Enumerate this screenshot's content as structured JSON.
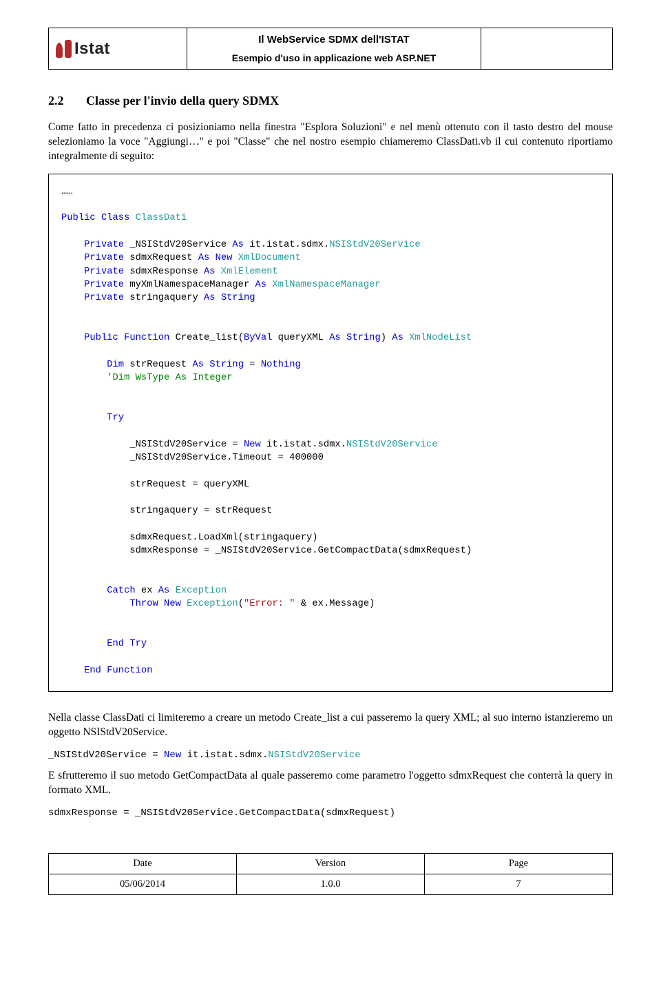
{
  "header": {
    "logo_text": "Istat",
    "title_line1": "Il WebService SDMX dell'ISTAT",
    "title_line2": "Esempio d'uso in applicazione web ASP.NET"
  },
  "section": {
    "num": "2.2",
    "title": "Classe per l'invio della query SDMX"
  },
  "para1": "Come fatto in precedenza ci posizioniamo nella finestra \"Esplora Soluzioni\" e nel menù ottenuto con il tasto destro del mouse selezioniamo la voce \"Aggiungi…\" e poi \"Classe\" che nel nostro esempio chiameremo ClassDati.vb il cui contenuto riportiamo integralmente di seguito:",
  "code": {
    "ellipsis": "……",
    "l1_kw1": "Public",
    "l1_kw2": "Class",
    "l1_type": "ClassDati",
    "l2_kw1": "Private",
    "l2_name": "_NSIStdV20Service",
    "l2_kw2": "As",
    "l2_ns": "it.istat.sdmx.",
    "l2_type": "NSIStdV20Service",
    "l3_kw1": "Private",
    "l3_name": "sdmxRequest",
    "l3_kw2": "As",
    "l3_kw3": "New",
    "l3_type": "XmlDocument",
    "l4_kw1": "Private",
    "l4_name": "sdmxResponse",
    "l4_kw2": "As",
    "l4_type": "XmlElement",
    "l5_kw1": "Private",
    "l5_name": "myXmlNamespaceManager",
    "l5_kw2": "As",
    "l5_type": "XmlNamespaceManager",
    "l6_kw1": "Private",
    "l6_name": "stringaquery",
    "l6_kw2": "As",
    "l6_kw3": "String",
    "l7_kw1": "Public",
    "l7_kw2": "Function",
    "l7_name": "Create_list(",
    "l7_kw3": "ByVal",
    "l7_arg": "queryXML",
    "l7_kw4": "As",
    "l7_kw5": "String",
    "l7_close": ")",
    "l7_kw6": "As",
    "l7_type": "XmlNodeList",
    "l8_kw1": "Dim",
    "l8_name": "strRequest",
    "l8_kw2": "As",
    "l8_kw3": "String",
    "l8_eq": " = ",
    "l8_kw4": "Nothing",
    "l9_cmt": "'Dim WsType As Integer",
    "l10_kw": "Try",
    "l11_a": "_NSIStdV20Service = ",
    "l11_kw": "New",
    "l11_ns": " it.istat.sdmx.",
    "l11_type": "NSIStdV20Service",
    "l12": "_NSIStdV20Service.Timeout = 400000",
    "l13": "strRequest = queryXML",
    "l14": "stringaquery = strRequest",
    "l15": "sdmxRequest.LoadXml(stringaquery)",
    "l16": "sdmxResponse = _NSIStdV20Service.GetCompactData(sdmxRequest)",
    "l17_kw1": "Catch",
    "l17_name": " ex ",
    "l17_kw2": "As",
    "l17_type": " Exception",
    "l18_kw1": "Throw",
    "l18_kw2": "New",
    "l18_type": "Exception",
    "l18_open": "(",
    "l18_str": "\"Error: \"",
    "l18_rest": " & ex.Message)",
    "l19_kw1": "End",
    "l19_kw2": "Try",
    "l20_kw1": "End",
    "l20_kw2": "Function"
  },
  "para2": "Nella classe ClassDati ci limiteremo a creare un metodo Create_list a cui passeremo la query XML; al suo interno istanzieremo un oggetto NSIStdV20Service.",
  "inline1": {
    "a": "_NSIStdV20Service = ",
    "kw": "New",
    "ns": " it.istat.sdmx.",
    "type": "NSIStdV20Service"
  },
  "para3": "E sfrutteremo il suo metodo GetCompactData al quale passeremo come parametro l'oggetto sdmxRequest che conterrà la query in formato XML.",
  "inline2": "sdmxResponse = _NSIStdV20Service.GetCompactData(sdmxRequest)",
  "footer": {
    "h1": "Date",
    "h2": "Version",
    "h3": "Page",
    "v1": "05/06/2014",
    "v2": "1.0.0",
    "v3": "7"
  }
}
